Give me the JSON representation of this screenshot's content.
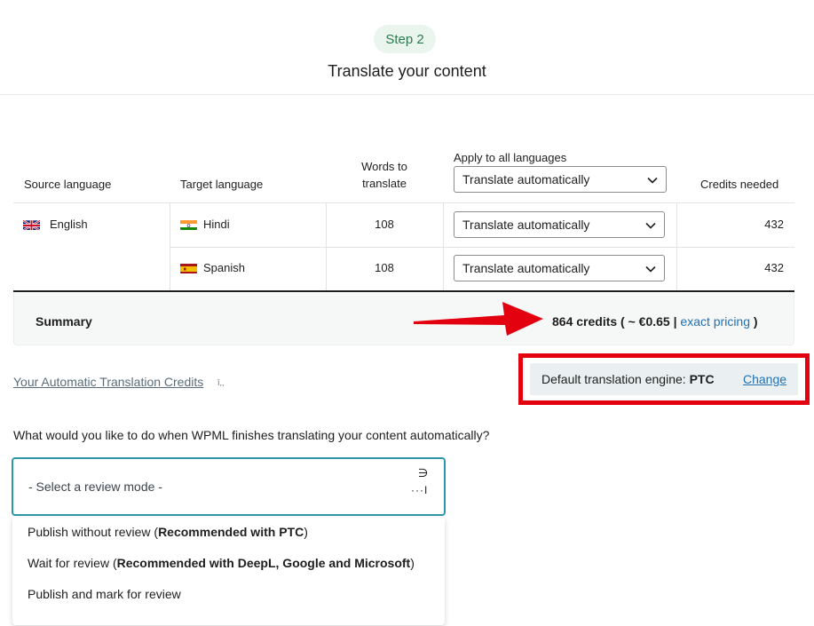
{
  "header": {
    "step_label": "Step 2",
    "title": "Translate your content"
  },
  "table": {
    "columns": {
      "source": "Source language",
      "target": "Target language",
      "words_line1": "Words to",
      "words_line2": "translate",
      "apply_label": "Apply to all languages",
      "apply_value": "Translate automatically",
      "credits": "Credits needed"
    },
    "source_language": "English",
    "rows": [
      {
        "target": "Hindi",
        "words": "108",
        "mode": "Translate automatically",
        "credits": "432"
      },
      {
        "target": "Spanish",
        "words": "108",
        "mode": "Translate automatically",
        "credits": "432"
      }
    ]
  },
  "summary": {
    "label": "Summary",
    "credits_text": "864 credits ( ~ €0.65 | ",
    "pricing_link": "exact pricing",
    "close_paren": " )"
  },
  "credits_link": "Your Automatic Translation Credits",
  "engine": {
    "prefix": "Default translation engine: ",
    "name": "PTC",
    "change_link": "Change"
  },
  "review": {
    "question": "What would you like to do when WPML finishes translating your content automatically?",
    "placeholder": "- Select a review mode -",
    "options": [
      {
        "text": "Publish without review (",
        "bold": "Recommended with PTC",
        "tail": ")"
      },
      {
        "text": "Wait for review (",
        "bold": "Recommended with DeepL, Google and Microsoft",
        "tail": ")"
      },
      {
        "text": "Publish and mark for review",
        "bold": "",
        "tail": ""
      }
    ]
  },
  "colors": {
    "accent_teal": "#2c98a6",
    "highlight_red": "#e3000f",
    "link_blue": "#2271b1",
    "step_green": "#2b7a4e"
  }
}
